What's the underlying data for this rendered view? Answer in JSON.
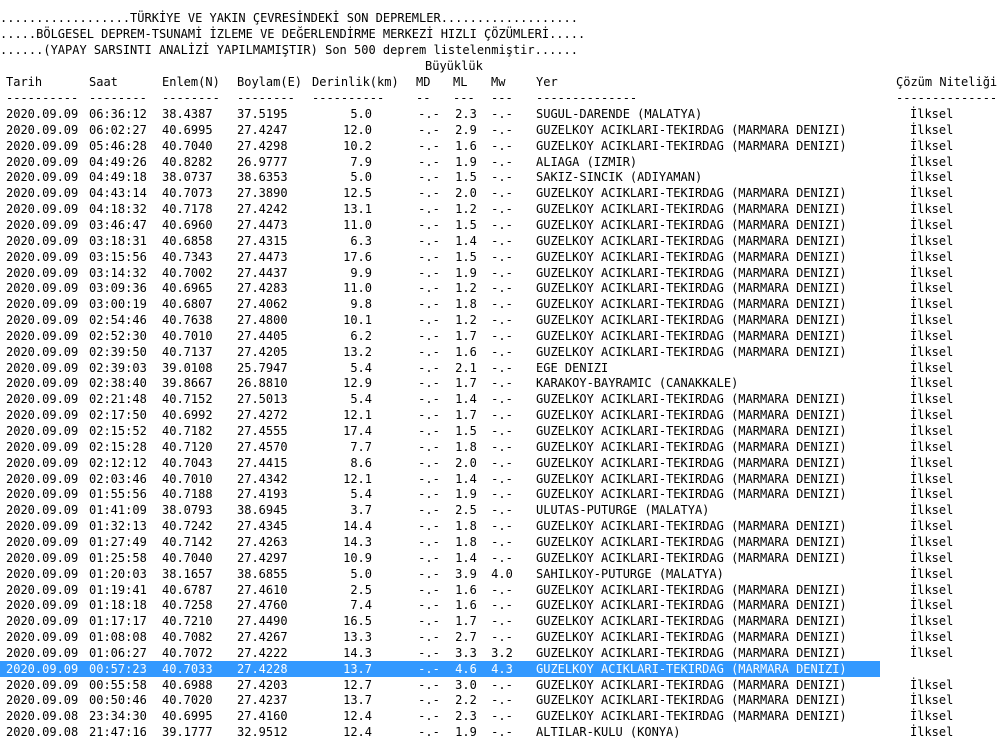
{
  "header": {
    "line1": "..................TÜRKİYE VE YAKIN ÇEVRESİNDEKİ SON DEPREMLER...................",
    "line2": ".....BÖLGESEL DEPREM-TSUNAMİ İZLEME VE DEĞERLENDİRME MERKEZİ HIZLI ÇÖZÜMLERİ.....",
    "line3": "......(YAPAY SARSINTI ANALİZİ YAPILMAMIŞTIR) Son 500 deprem listelenmiştir......"
  },
  "columns": {
    "group_magnitude": "Büyüklük",
    "tarih": "Tarih",
    "saat": "Saat",
    "enlem": "Enlem(N)",
    "boylam": "Boylam(E)",
    "derinlik": "Derinlik(km)",
    "md": "MD",
    "ml": "ML",
    "mw": "Mw",
    "yer": "Yer",
    "cozum": "Çözüm Niteliği"
  },
  "separators": {
    "tarih": "----------",
    "saat": "--------",
    "enlem": "--------",
    "boylam": "--------",
    "derinlik": "----------",
    "md": "--",
    "ml": "---",
    "mw": "---",
    "yer": "--------------",
    "cozum": "--------------"
  },
  "rows": [
    {
      "tarih": "2020.09.09",
      "saat": "06:36:12",
      "enlem": "38.4387",
      "boylam": "37.5195",
      "derinlik": "5.0",
      "md": "-.-",
      "ml": "2.3",
      "mw": "-.-",
      "yer": "SUGUL-DARENDE (MALATYA)",
      "cozum": "İlksel"
    },
    {
      "tarih": "2020.09.09",
      "saat": "06:02:27",
      "enlem": "40.6995",
      "boylam": "27.4247",
      "derinlik": "12.0",
      "md": "-.-",
      "ml": "2.9",
      "mw": "-.-",
      "yer": "GUZELKOY ACIKLARI-TEKIRDAG (MARMARA DENIZI)",
      "cozum": "İlksel"
    },
    {
      "tarih": "2020.09.09",
      "saat": "05:46:28",
      "enlem": "40.7040",
      "boylam": "27.4298",
      "derinlik": "10.2",
      "md": "-.-",
      "ml": "1.6",
      "mw": "-.-",
      "yer": "GUZELKOY ACIKLARI-TEKIRDAG (MARMARA DENIZI)",
      "cozum": "İlksel"
    },
    {
      "tarih": "2020.09.09",
      "saat": "04:49:26",
      "enlem": "40.8282",
      "boylam": "26.9777",
      "derinlik": "7.9",
      "md": "-.-",
      "ml": "1.9",
      "mw": "-.-",
      "yer": "ALIAGA (IZMIR)",
      "cozum": "İlksel"
    },
    {
      "tarih": "2020.09.09",
      "saat": "04:49:18",
      "enlem": "38.0737",
      "boylam": "38.6353",
      "derinlik": "5.0",
      "md": "-.-",
      "ml": "1.5",
      "mw": "-.-",
      "yer": "SAKIZ-SINCIK (ADIYAMAN)",
      "cozum": "İlksel"
    },
    {
      "tarih": "2020.09.09",
      "saat": "04:43:14",
      "enlem": "40.7073",
      "boylam": "27.3890",
      "derinlik": "12.5",
      "md": "-.-",
      "ml": "2.0",
      "mw": "-.-",
      "yer": "GUZELKOY ACIKLARI-TEKIRDAG (MARMARA DENIZI)",
      "cozum": "İlksel"
    },
    {
      "tarih": "2020.09.09",
      "saat": "04:18:32",
      "enlem": "40.7178",
      "boylam": "27.4242",
      "derinlik": "13.1",
      "md": "-.-",
      "ml": "1.2",
      "mw": "-.-",
      "yer": "GUZELKOY ACIKLARI-TEKIRDAG (MARMARA DENIZI)",
      "cozum": "İlksel"
    },
    {
      "tarih": "2020.09.09",
      "saat": "03:46:47",
      "enlem": "40.6960",
      "boylam": "27.4473",
      "derinlik": "11.0",
      "md": "-.-",
      "ml": "1.5",
      "mw": "-.-",
      "yer": "GUZELKOY ACIKLARI-TEKIRDAG (MARMARA DENIZI)",
      "cozum": "İlksel"
    },
    {
      "tarih": "2020.09.09",
      "saat": "03:18:31",
      "enlem": "40.6858",
      "boylam": "27.4315",
      "derinlik": "6.3",
      "md": "-.-",
      "ml": "1.4",
      "mw": "-.-",
      "yer": "GUZELKOY ACIKLARI-TEKIRDAG (MARMARA DENIZI)",
      "cozum": "İlksel"
    },
    {
      "tarih": "2020.09.09",
      "saat": "03:15:56",
      "enlem": "40.7343",
      "boylam": "27.4473",
      "derinlik": "17.6",
      "md": "-.-",
      "ml": "1.5",
      "mw": "-.-",
      "yer": "GUZELKOY ACIKLARI-TEKIRDAG (MARMARA DENIZI)",
      "cozum": "İlksel"
    },
    {
      "tarih": "2020.09.09",
      "saat": "03:14:32",
      "enlem": "40.7002",
      "boylam": "27.4437",
      "derinlik": "9.9",
      "md": "-.-",
      "ml": "1.9",
      "mw": "-.-",
      "yer": "GUZELKOY ACIKLARI-TEKIRDAG (MARMARA DENIZI)",
      "cozum": "İlksel"
    },
    {
      "tarih": "2020.09.09",
      "saat": "03:09:36",
      "enlem": "40.6965",
      "boylam": "27.4283",
      "derinlik": "11.0",
      "md": "-.-",
      "ml": "1.2",
      "mw": "-.-",
      "yer": "GUZELKOY ACIKLARI-TEKIRDAG (MARMARA DENIZI)",
      "cozum": "İlksel"
    },
    {
      "tarih": "2020.09.09",
      "saat": "03:00:19",
      "enlem": "40.6807",
      "boylam": "27.4062",
      "derinlik": "9.8",
      "md": "-.-",
      "ml": "1.8",
      "mw": "-.-",
      "yer": "GUZELKOY ACIKLARI-TEKIRDAG (MARMARA DENIZI)",
      "cozum": "İlksel"
    },
    {
      "tarih": "2020.09.09",
      "saat": "02:54:46",
      "enlem": "40.7638",
      "boylam": "27.4800",
      "derinlik": "10.1",
      "md": "-.-",
      "ml": "1.2",
      "mw": "-.-",
      "yer": "GUZELKOY ACIKLARI-TEKIRDAG (MARMARA DENIZI)",
      "cozum": "İlksel"
    },
    {
      "tarih": "2020.09.09",
      "saat": "02:52:30",
      "enlem": "40.7010",
      "boylam": "27.4405",
      "derinlik": "6.2",
      "md": "-.-",
      "ml": "1.7",
      "mw": "-.-",
      "yer": "GUZELKOY ACIKLARI-TEKIRDAG (MARMARA DENIZI)",
      "cozum": "İlksel"
    },
    {
      "tarih": "2020.09.09",
      "saat": "02:39:50",
      "enlem": "40.7137",
      "boylam": "27.4205",
      "derinlik": "13.2",
      "md": "-.-",
      "ml": "1.6",
      "mw": "-.-",
      "yer": "GUZELKOY ACIKLARI-TEKIRDAG (MARMARA DENIZI)",
      "cozum": "İlksel"
    },
    {
      "tarih": "2020.09.09",
      "saat": "02:39:03",
      "enlem": "39.0108",
      "boylam": "25.7947",
      "derinlik": "5.4",
      "md": "-.-",
      "ml": "2.1",
      "mw": "-.-",
      "yer": "EGE DENIZI",
      "cozum": "İlksel"
    },
    {
      "tarih": "2020.09.09",
      "saat": "02:38:40",
      "enlem": "39.8667",
      "boylam": "26.8810",
      "derinlik": "12.9",
      "md": "-.-",
      "ml": "1.7",
      "mw": "-.-",
      "yer": "KARAKOY-BAYRAMIC (CANAKKALE)",
      "cozum": "İlksel"
    },
    {
      "tarih": "2020.09.09",
      "saat": "02:21:48",
      "enlem": "40.7152",
      "boylam": "27.5013",
      "derinlik": "5.4",
      "md": "-.-",
      "ml": "1.4",
      "mw": "-.-",
      "yer": "GUZELKOY ACIKLARI-TEKIRDAG (MARMARA DENIZI)",
      "cozum": "İlksel"
    },
    {
      "tarih": "2020.09.09",
      "saat": "02:17:50",
      "enlem": "40.6992",
      "boylam": "27.4272",
      "derinlik": "12.1",
      "md": "-.-",
      "ml": "1.7",
      "mw": "-.-",
      "yer": "GUZELKOY ACIKLARI-TEKIRDAG (MARMARA DENIZI)",
      "cozum": "İlksel"
    },
    {
      "tarih": "2020.09.09",
      "saat": "02:15:52",
      "enlem": "40.7182",
      "boylam": "27.4555",
      "derinlik": "17.4",
      "md": "-.-",
      "ml": "1.5",
      "mw": "-.-",
      "yer": "GUZELKOY ACIKLARI-TEKIRDAG (MARMARA DENIZI)",
      "cozum": "İlksel"
    },
    {
      "tarih": "2020.09.09",
      "saat": "02:15:28",
      "enlem": "40.7120",
      "boylam": "27.4570",
      "derinlik": "7.7",
      "md": "-.-",
      "ml": "1.8",
      "mw": "-.-",
      "yer": "GUZELKOY ACIKLARI-TEKIRDAG (MARMARA DENIZI)",
      "cozum": "İlksel"
    },
    {
      "tarih": "2020.09.09",
      "saat": "02:12:12",
      "enlem": "40.7043",
      "boylam": "27.4415",
      "derinlik": "8.6",
      "md": "-.-",
      "ml": "2.0",
      "mw": "-.-",
      "yer": "GUZELKOY ACIKLARI-TEKIRDAG (MARMARA DENIZI)",
      "cozum": "İlksel"
    },
    {
      "tarih": "2020.09.09",
      "saat": "02:03:46",
      "enlem": "40.7010",
      "boylam": "27.4342",
      "derinlik": "12.1",
      "md": "-.-",
      "ml": "1.4",
      "mw": "-.-",
      "yer": "GUZELKOY ACIKLARI-TEKIRDAG (MARMARA DENIZI)",
      "cozum": "İlksel"
    },
    {
      "tarih": "2020.09.09",
      "saat": "01:55:56",
      "enlem": "40.7188",
      "boylam": "27.4193",
      "derinlik": "5.4",
      "md": "-.-",
      "ml": "1.9",
      "mw": "-.-",
      "yer": "GUZELKOY ACIKLARI-TEKIRDAG (MARMARA DENIZI)",
      "cozum": "İlksel"
    },
    {
      "tarih": "2020.09.09",
      "saat": "01:41:09",
      "enlem": "38.0793",
      "boylam": "38.6945",
      "derinlik": "3.7",
      "md": "-.-",
      "ml": "2.5",
      "mw": "-.-",
      "yer": "ULUTAS-PUTURGE (MALATYA)",
      "cozum": "İlksel"
    },
    {
      "tarih": "2020.09.09",
      "saat": "01:32:13",
      "enlem": "40.7242",
      "boylam": "27.4345",
      "derinlik": "14.4",
      "md": "-.-",
      "ml": "1.8",
      "mw": "-.-",
      "yer": "GUZELKOY ACIKLARI-TEKIRDAG (MARMARA DENIZI)",
      "cozum": "İlksel"
    },
    {
      "tarih": "2020.09.09",
      "saat": "01:27:49",
      "enlem": "40.7142",
      "boylam": "27.4263",
      "derinlik": "14.3",
      "md": "-.-",
      "ml": "1.8",
      "mw": "-.-",
      "yer": "GUZELKOY ACIKLARI-TEKIRDAG (MARMARA DENIZI)",
      "cozum": "İlksel"
    },
    {
      "tarih": "2020.09.09",
      "saat": "01:25:58",
      "enlem": "40.7040",
      "boylam": "27.4297",
      "derinlik": "10.9",
      "md": "-.-",
      "ml": "1.4",
      "mw": "-.-",
      "yer": "GUZELKOY ACIKLARI-TEKIRDAG (MARMARA DENIZI)",
      "cozum": "İlksel"
    },
    {
      "tarih": "2020.09.09",
      "saat": "01:20:03",
      "enlem": "38.1657",
      "boylam": "38.6855",
      "derinlik": "5.0",
      "md": "-.-",
      "ml": "3.9",
      "mw": "4.0",
      "yer": "SAHILKOY-PUTURGE (MALATYA)",
      "cozum": "İlksel"
    },
    {
      "tarih": "2020.09.09",
      "saat": "01:19:41",
      "enlem": "40.6787",
      "boylam": "27.4610",
      "derinlik": "2.5",
      "md": "-.-",
      "ml": "1.6",
      "mw": "-.-",
      "yer": "GUZELKOY ACIKLARI-TEKIRDAG (MARMARA DENIZI)",
      "cozum": "İlksel"
    },
    {
      "tarih": "2020.09.09",
      "saat": "01:18:18",
      "enlem": "40.7258",
      "boylam": "27.4760",
      "derinlik": "7.4",
      "md": "-.-",
      "ml": "1.6",
      "mw": "-.-",
      "yer": "GUZELKOY ACIKLARI-TEKIRDAG (MARMARA DENIZI)",
      "cozum": "İlksel"
    },
    {
      "tarih": "2020.09.09",
      "saat": "01:17:17",
      "enlem": "40.7210",
      "boylam": "27.4490",
      "derinlik": "16.5",
      "md": "-.-",
      "ml": "1.7",
      "mw": "-.-",
      "yer": "GUZELKOY ACIKLARI-TEKIRDAG (MARMARA DENIZI)",
      "cozum": "İlksel"
    },
    {
      "tarih": "2020.09.09",
      "saat": "01:08:08",
      "enlem": "40.7082",
      "boylam": "27.4267",
      "derinlik": "13.3",
      "md": "-.-",
      "ml": "2.7",
      "mw": "-.-",
      "yer": "GUZELKOY ACIKLARI-TEKIRDAG (MARMARA DENIZI)",
      "cozum": "İlksel"
    },
    {
      "tarih": "2020.09.09",
      "saat": "01:06:27",
      "enlem": "40.7072",
      "boylam": "27.4222",
      "derinlik": "14.3",
      "md": "-.-",
      "ml": "3.3",
      "mw": "3.2",
      "yer": "GUZELKOY ACIKLARI-TEKIRDAG (MARMARA DENIZI)",
      "cozum": "İlksel"
    },
    {
      "tarih": "2020.09.09",
      "saat": "00:57:23",
      "enlem": "40.7033",
      "boylam": "27.4228",
      "derinlik": "13.7",
      "md": "-.-",
      "ml": "4.6",
      "mw": "4.3",
      "yer": "GUZELKOY ACIKLARI-TEKIRDAG (MARMARA DENIZI)",
      "cozum": "İlksel",
      "selected": true
    },
    {
      "tarih": "2020.09.09",
      "saat": "00:55:58",
      "enlem": "40.6988",
      "boylam": "27.4203",
      "derinlik": "12.7",
      "md": "-.-",
      "ml": "3.0",
      "mw": "-.-",
      "yer": "GUZELKOY ACIKLARI-TEKIRDAG (MARMARA DENIZI)",
      "cozum": "İlksel"
    },
    {
      "tarih": "2020.09.09",
      "saat": "00:50:46",
      "enlem": "40.7020",
      "boylam": "27.4237",
      "derinlik": "13.7",
      "md": "-.-",
      "ml": "2.2",
      "mw": "-.-",
      "yer": "GUZELKOY ACIKLARI-TEKIRDAG (MARMARA DENIZI)",
      "cozum": "İlksel"
    },
    {
      "tarih": "2020.09.08",
      "saat": "23:34:30",
      "enlem": "40.6995",
      "boylam": "27.4160",
      "derinlik": "12.4",
      "md": "-.-",
      "ml": "2.3",
      "mw": "-.-",
      "yer": "GUZELKOY ACIKLARI-TEKIRDAG (MARMARA DENIZI)",
      "cozum": "İlksel"
    },
    {
      "tarih": "2020.09.08",
      "saat": "21:47:16",
      "enlem": "39.1777",
      "boylam": "32.9512",
      "derinlik": "12.4",
      "md": "-.-",
      "ml": "1.9",
      "mw": "-.-",
      "yer": "ALTILAR-KULU (KONYA)",
      "cozum": "İlksel"
    }
  ]
}
